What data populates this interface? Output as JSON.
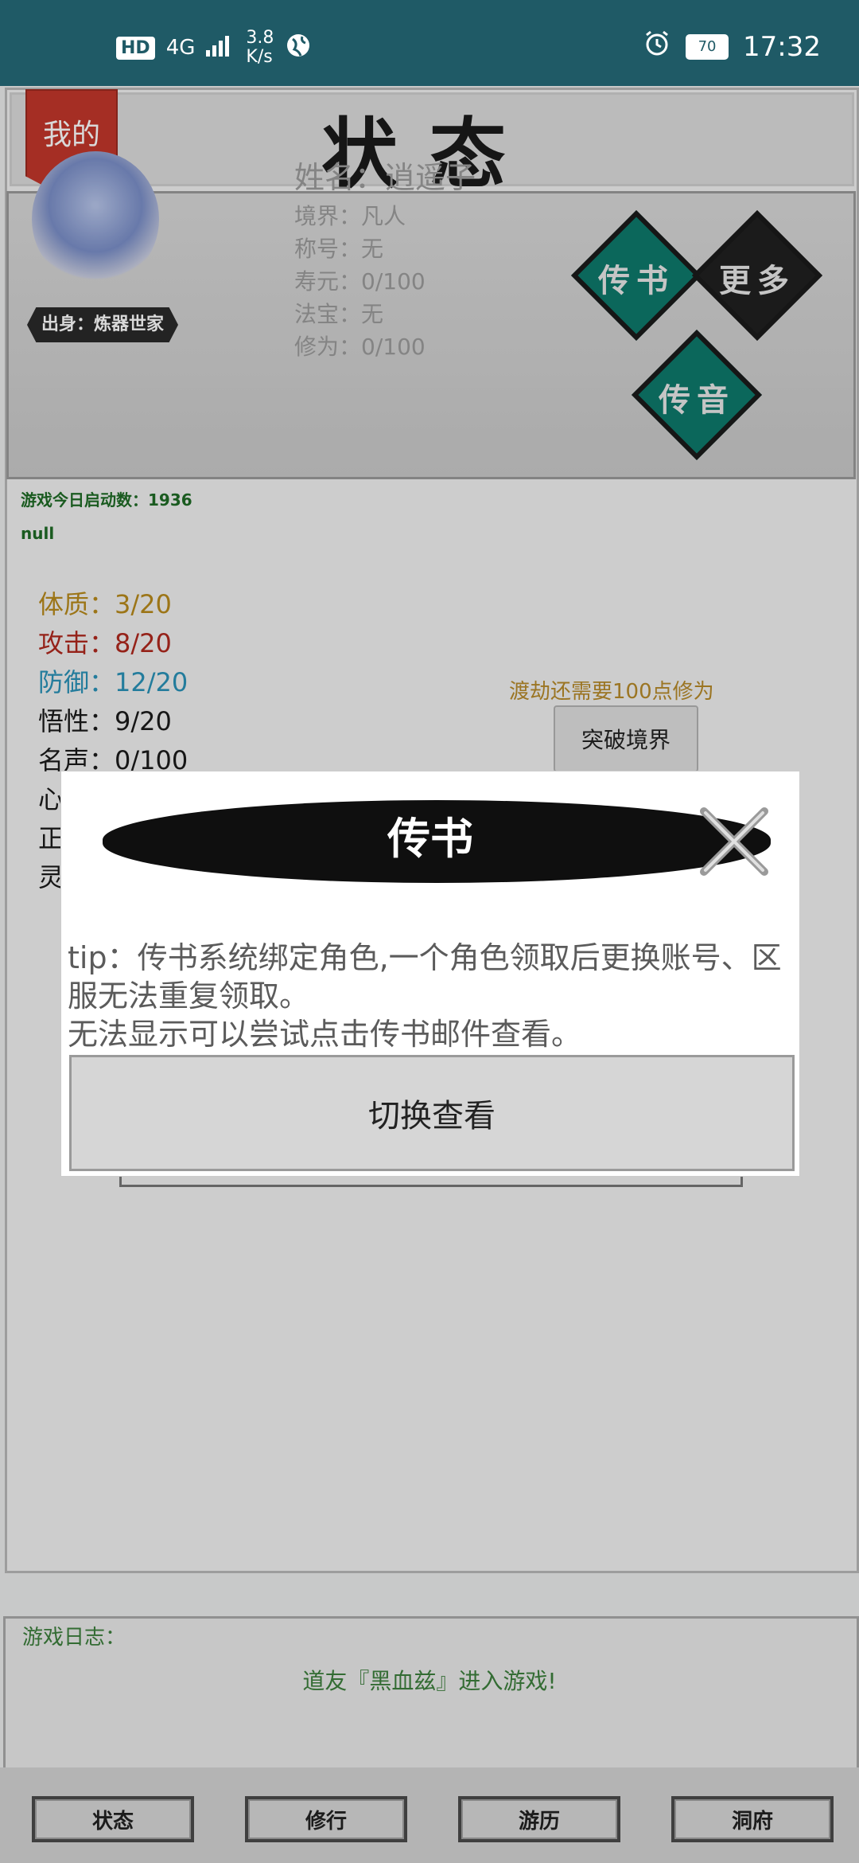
{
  "status_bar": {
    "hd": "HD",
    "network": "4G",
    "speed": "3.8",
    "speed_unit": "K/s",
    "battery": "70",
    "time": "17:32"
  },
  "header": {
    "title": "状态",
    "mine_badge": "我的"
  },
  "profile": {
    "name": "姓名：逍遥子",
    "realm": "境界：凡人",
    "honorific": "称号：无",
    "lifespan": "寿元：0/100",
    "treasure": "法宝：无",
    "cultivation": "修为：0/100",
    "origin": "出身：炼器世家",
    "btn_chuanshu": "传书",
    "btn_more": "更多",
    "btn_chuanyin": "传音"
  },
  "info": {
    "launches": "游戏今日启动数：1936",
    "null_text": "null"
  },
  "attributes": [
    {
      "text": "体质：3/20",
      "color": "#b88a1c"
    },
    {
      "text": "攻击：8/20",
      "color": "#b0281e"
    },
    {
      "text": "防御：12/20",
      "color": "#2a92b8"
    },
    {
      "text": "悟性：9/20",
      "color": "#1a1a1a"
    },
    {
      "text": "名声：0/100",
      "color": "#1a1a1a"
    },
    {
      "text": "心",
      "color": "#1a1a1a"
    },
    {
      "text": "正",
      "color": "#1a1a1a"
    },
    {
      "text": "灵",
      "color": "#1a1a1a"
    }
  ],
  "breakthrough": {
    "note": "渡劫还需要100点修为",
    "button": "突破境界"
  },
  "dialog": {
    "title": "传书",
    "tip_line1": "tip：传书系统绑定角色,一个角色领取后更换账号、区服无法重复领取。",
    "tip_line2": "无法显示可以尝试点击传书邮件查看。",
    "button": "切换查看"
  },
  "log": {
    "title": "游戏日志：",
    "entry": "道友『黑血兹』进入游戏!"
  },
  "tabs": [
    "状态",
    "修行",
    "游历",
    "洞府"
  ]
}
